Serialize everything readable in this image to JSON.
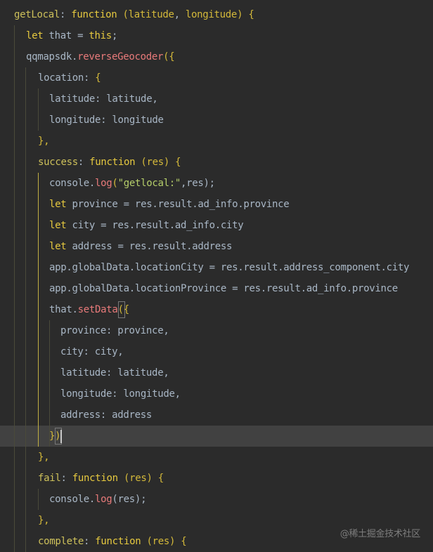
{
  "colors": {
    "background": "#2b2b2b",
    "current_line": "#414141",
    "default": "#a9b7c6",
    "keyword": "#e6c93f",
    "function_name": "#ffc66d",
    "property": "#cdc05a",
    "method": "#e87a7a",
    "string": "#b5ce6a",
    "bracket": "#d4b93a",
    "active_guide": "#bfae43"
  },
  "code_lines": [
    {
      "tokens": [
        {
          "t": "getLocal",
          "k": "property"
        },
        {
          "t": ": ",
          "k": "default"
        },
        {
          "t": "function",
          "k": "keyword"
        },
        {
          "t": " (",
          "k": "bracket"
        },
        {
          "t": "latitude",
          "k": "param"
        },
        {
          "t": ", ",
          "k": "default"
        },
        {
          "t": "longitude",
          "k": "param"
        },
        {
          "t": ") {",
          "k": "bracket"
        }
      ]
    },
    {
      "tokens": [
        {
          "t": "let",
          "k": "keyword"
        },
        {
          "t": " that = ",
          "k": "default"
        },
        {
          "t": "this",
          "k": "keyword"
        },
        {
          "t": ";",
          "k": "default"
        }
      ]
    },
    {
      "tokens": [
        {
          "t": "qqmapsdk.",
          "k": "default"
        },
        {
          "t": "reverseGeocoder",
          "k": "method"
        },
        {
          "t": "({",
          "k": "bracket"
        }
      ]
    },
    {
      "tokens": [
        {
          "t": "location",
          "k": "default"
        },
        {
          "t": ": ",
          "k": "default"
        },
        {
          "t": "{",
          "k": "bracket"
        }
      ]
    },
    {
      "tokens": [
        {
          "t": "latitude",
          "k": "default"
        },
        {
          "t": ": latitude,",
          "k": "default"
        }
      ]
    },
    {
      "tokens": [
        {
          "t": "longitude",
          "k": "default"
        },
        {
          "t": ": longitude",
          "k": "default"
        }
      ]
    },
    {
      "tokens": [
        {
          "t": "},",
          "k": "bracket"
        }
      ]
    },
    {
      "tokens": [
        {
          "t": "success",
          "k": "property"
        },
        {
          "t": ": ",
          "k": "default"
        },
        {
          "t": "function",
          "k": "keyword"
        },
        {
          "t": " (",
          "k": "bracket"
        },
        {
          "t": "res",
          "k": "param"
        },
        {
          "t": ") {",
          "k": "bracket"
        }
      ]
    },
    {
      "tokens": [
        {
          "t": "console.",
          "k": "default"
        },
        {
          "t": "log",
          "k": "method"
        },
        {
          "t": "(",
          "k": "bracket"
        },
        {
          "t": "\"getlocal:\"",
          "k": "string"
        },
        {
          "t": ",res);",
          "k": "default"
        }
      ]
    },
    {
      "tokens": [
        {
          "t": "let",
          "k": "keyword"
        },
        {
          "t": " province = res.result.ad_info.province",
          "k": "default"
        }
      ]
    },
    {
      "tokens": [
        {
          "t": "let",
          "k": "keyword"
        },
        {
          "t": " city = res.result.ad_info.city",
          "k": "default"
        }
      ]
    },
    {
      "tokens": [
        {
          "t": "let",
          "k": "keyword"
        },
        {
          "t": " address = res.result.address",
          "k": "default"
        }
      ]
    },
    {
      "tokens": [
        {
          "t": "app.globalData.locationCity = res.result.address_component.city",
          "k": "default"
        }
      ]
    },
    {
      "tokens": [
        {
          "t": "app.globalData.locationProvince = res.result.ad_info.province",
          "k": "default"
        }
      ]
    },
    {
      "tokens": [
        {
          "t": "that.",
          "k": "default"
        },
        {
          "t": "setData",
          "k": "method"
        },
        {
          "t": "(",
          "k": "boxed"
        },
        {
          "t": "{",
          "k": "bracket"
        }
      ]
    },
    {
      "tokens": [
        {
          "t": "province",
          "k": "default"
        },
        {
          "t": ": province,",
          "k": "default"
        }
      ]
    },
    {
      "tokens": [
        {
          "t": "city",
          "k": "default"
        },
        {
          "t": ": city,",
          "k": "default"
        }
      ]
    },
    {
      "tokens": [
        {
          "t": "latitude",
          "k": "default"
        },
        {
          "t": ": latitude,",
          "k": "default"
        }
      ]
    },
    {
      "tokens": [
        {
          "t": "longitude",
          "k": "default"
        },
        {
          "t": ": longitude,",
          "k": "default"
        }
      ]
    },
    {
      "tokens": [
        {
          "t": "address",
          "k": "default"
        },
        {
          "t": ": address",
          "k": "default"
        }
      ]
    },
    {
      "tokens": [
        {
          "t": "}",
          "k": "bracket"
        },
        {
          "t": ")",
          "k": "boxed"
        }
      ]
    },
    {
      "tokens": [
        {
          "t": "},",
          "k": "bracket"
        }
      ]
    },
    {
      "tokens": [
        {
          "t": "fail",
          "k": "property"
        },
        {
          "t": ": ",
          "k": "default"
        },
        {
          "t": "function",
          "k": "keyword"
        },
        {
          "t": " (",
          "k": "bracket"
        },
        {
          "t": "res",
          "k": "param"
        },
        {
          "t": ") {",
          "k": "bracket"
        }
      ]
    },
    {
      "tokens": [
        {
          "t": "console.",
          "k": "default"
        },
        {
          "t": "log",
          "k": "method"
        },
        {
          "t": "(res);",
          "k": "default"
        }
      ]
    },
    {
      "tokens": [
        {
          "t": "},",
          "k": "bracket"
        }
      ]
    },
    {
      "tokens": [
        {
          "t": "complete",
          "k": "property"
        },
        {
          "t": ": ",
          "k": "default"
        },
        {
          "t": "function",
          "k": "keyword"
        },
        {
          "t": " (",
          "k": "bracket"
        },
        {
          "t": "res",
          "k": "param"
        },
        {
          "t": ") {",
          "k": "bracket"
        }
      ]
    }
  ],
  "watermark": "@稀土掘金技术社区"
}
